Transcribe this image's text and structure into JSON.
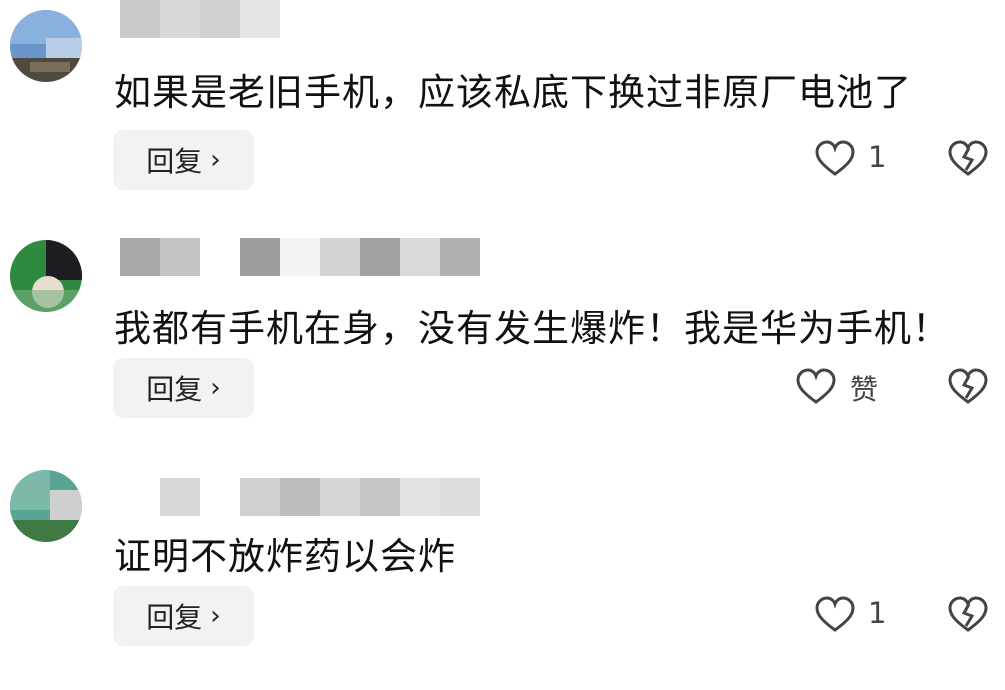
{
  "comments": [
    {
      "text": "如果是老旧手机，应该私底下换过非原厂电池了",
      "reply_label": "回复",
      "like_label": "1",
      "dislike_icon": "broken-heart-icon",
      "like_icon": "heart-icon"
    },
    {
      "text": "我都有手机在身，没有发生爆炸！我是华为手机！",
      "reply_label": "回复",
      "like_label": "赞",
      "dislike_icon": "broken-heart-icon",
      "like_icon": "heart-icon"
    },
    {
      "text": "证明不放炸药以会炸",
      "reply_label": "回复",
      "like_label": "1",
      "dislike_icon": "broken-heart-icon",
      "like_icon": "heart-icon"
    }
  ]
}
